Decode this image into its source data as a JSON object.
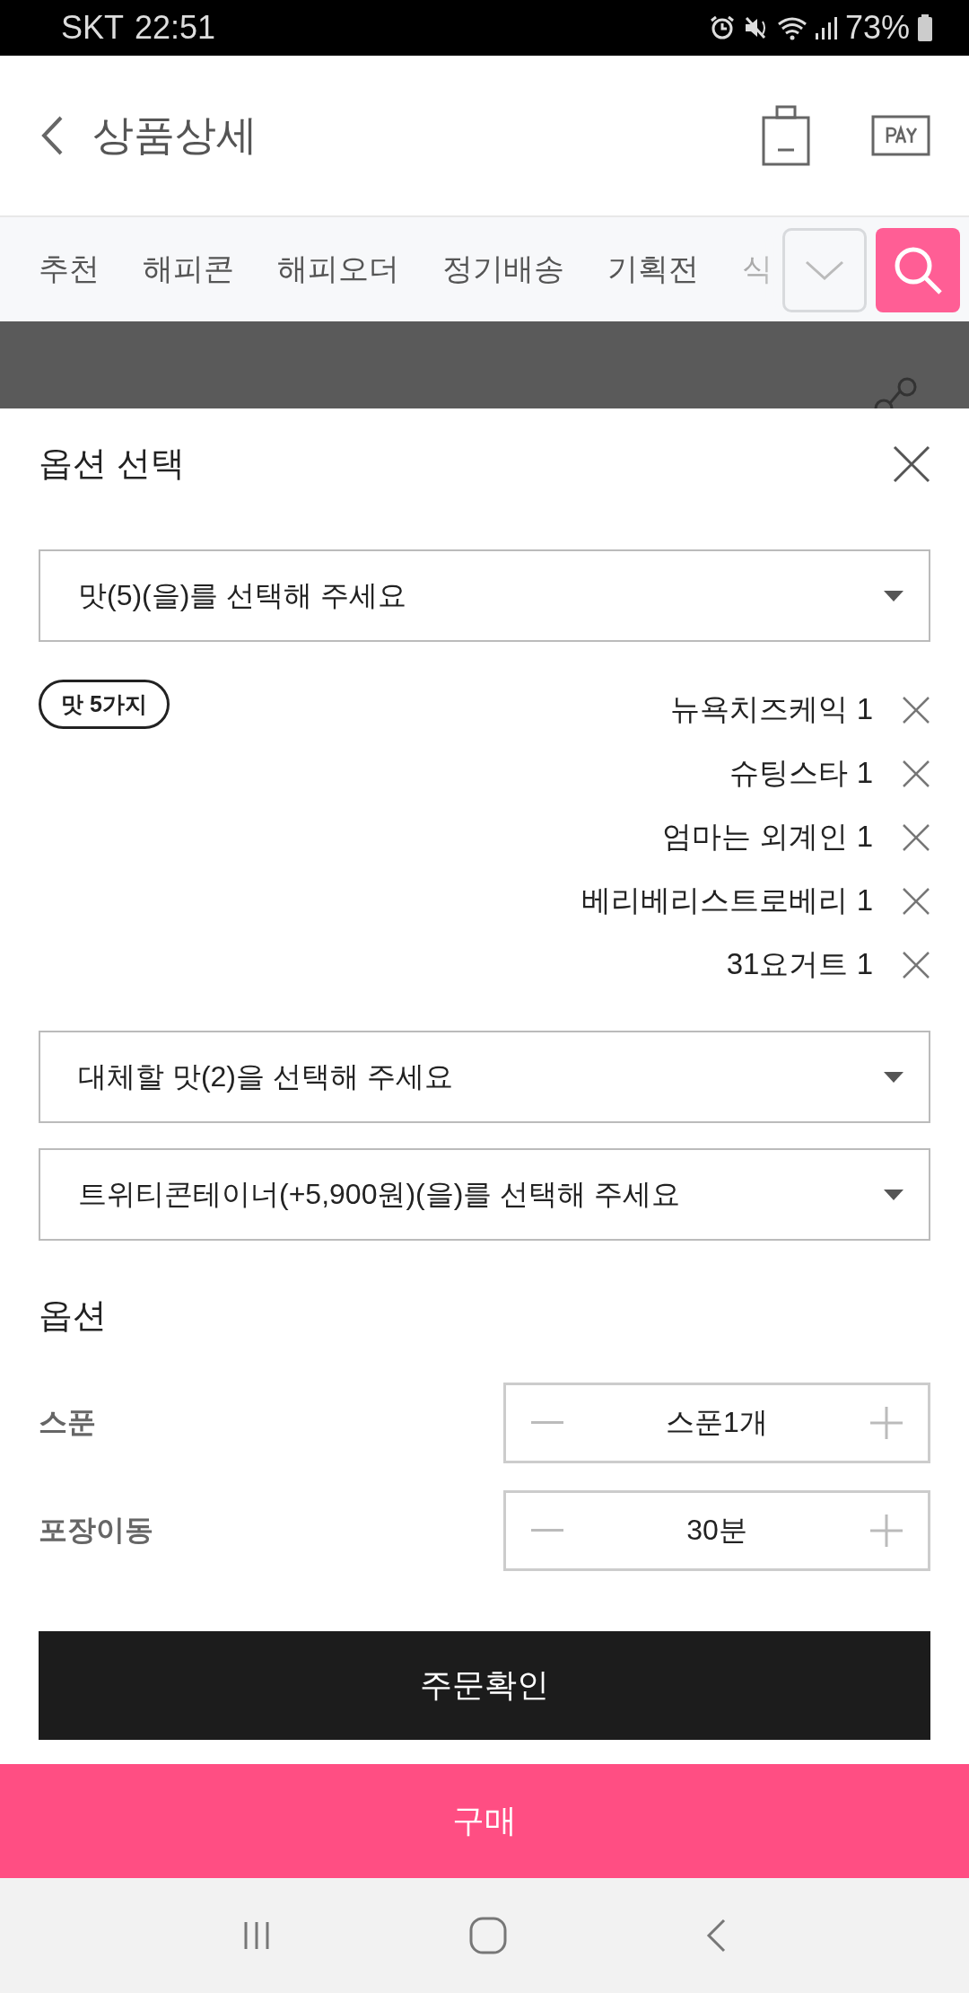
{
  "status_bar": {
    "carrier": "SKT",
    "time": "22:51",
    "battery": "73%"
  },
  "header": {
    "title": "상품상세"
  },
  "tabs": [
    {
      "label": "추천"
    },
    {
      "label": "해피콘"
    },
    {
      "label": "해피오더"
    },
    {
      "label": "정기배송"
    },
    {
      "label": "기획전"
    },
    {
      "label": "식"
    }
  ],
  "sheet": {
    "title": "옵션 선택",
    "selects": [
      {
        "placeholder": "맛(5)(을)를 선택해 주세요"
      }
    ],
    "badge": "맛 5가지",
    "chosen": [
      {
        "label": "뉴욕치즈케익 1"
      },
      {
        "label": "슈팅스타 1"
      },
      {
        "label": "엄마는 외계인 1"
      },
      {
        "label": "베리베리스트로베리 1"
      },
      {
        "label": "31요거트 1"
      }
    ],
    "more_selects": [
      {
        "placeholder": "대체할 맛(2)을 선택해 주세요"
      },
      {
        "placeholder": "트위티콘테이너(+5,900원)(을)를 선택해 주세요"
      }
    ],
    "options_title": "옵션",
    "options": [
      {
        "label": "스푼",
        "value": "스푼1개"
      },
      {
        "label": "포장이동",
        "value": "30분"
      }
    ],
    "confirm": "주문확인"
  },
  "buy": "구매"
}
